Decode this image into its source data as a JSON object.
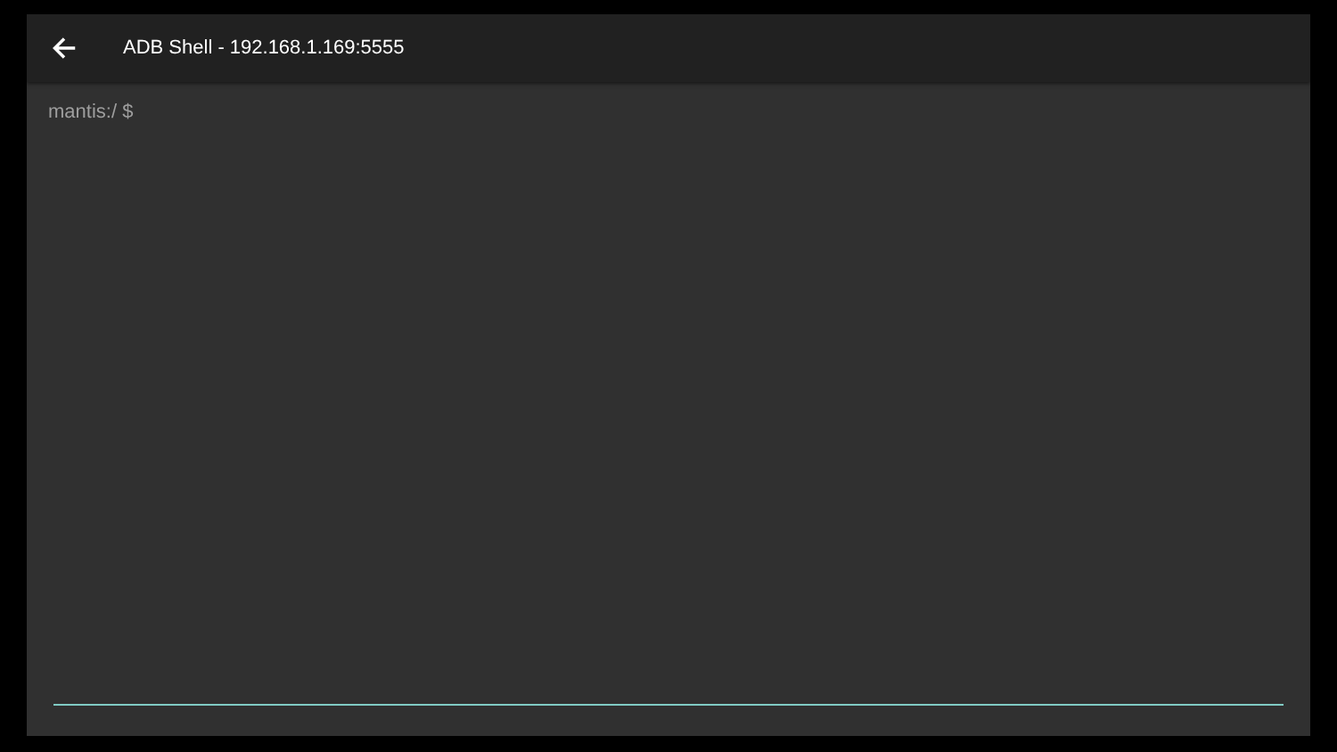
{
  "app_bar": {
    "title": "ADB Shell - 192.168.1.169:5555"
  },
  "terminal": {
    "output": "mantis:/ $"
  }
}
